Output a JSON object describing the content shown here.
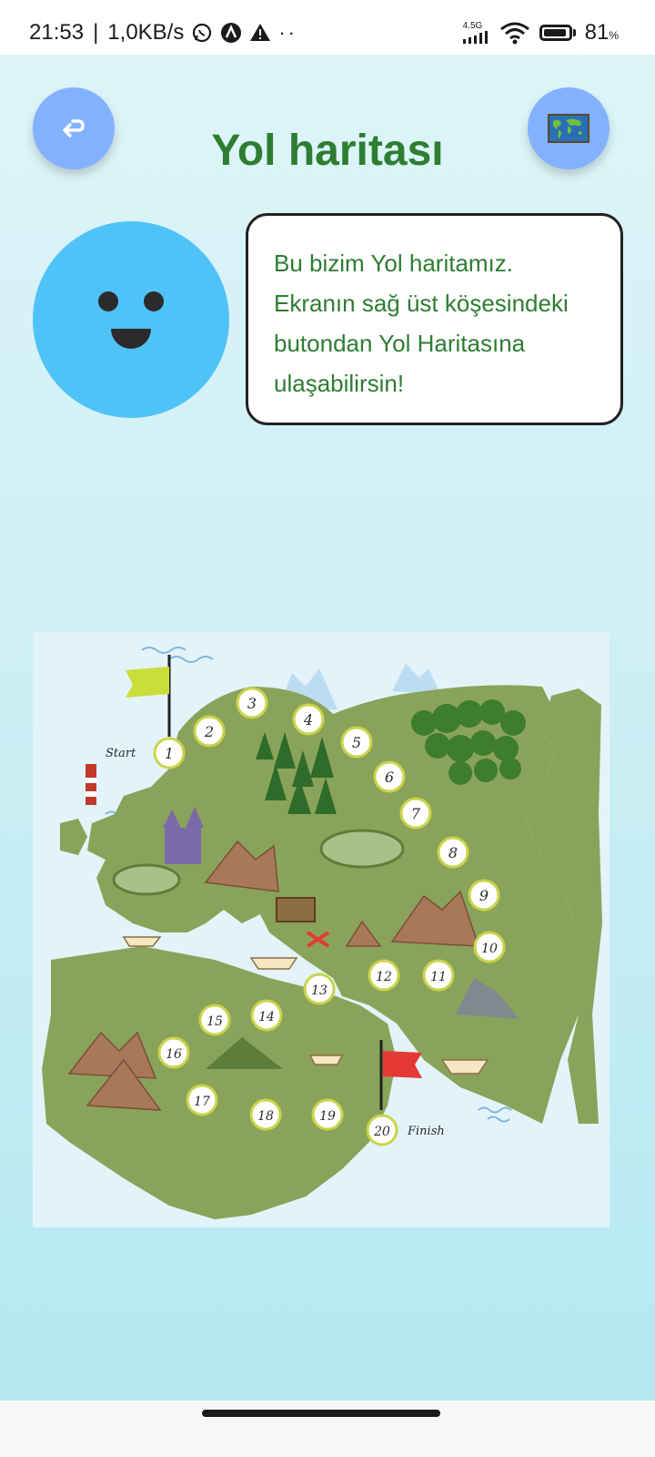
{
  "status_bar": {
    "time": "21:53",
    "speed": "1,0KB/s",
    "left_icons": [
      "whatsapp-icon",
      "app-a-icon",
      "warning-icon"
    ],
    "dots": "··",
    "network_label": "4.5G",
    "battery_percent": "81",
    "percent_sign": "%"
  },
  "header": {
    "title": "Yol haritası",
    "back_icon": "return-arrow-icon",
    "map_icon": "world-map-icon"
  },
  "speech_bubble": {
    "text": "Bu bizim Yol haritamız. Ekranın sağ üst köşesindeki butondan Yol Haritasına ulaşabilirsin!"
  },
  "roadmap": {
    "start_label": "Start",
    "finish_label": "Finish",
    "steps": [
      "1",
      "2",
      "3",
      "4",
      "5",
      "6",
      "7",
      "8",
      "9",
      "10",
      "11",
      "12",
      "13",
      "14",
      "15",
      "16",
      "17",
      "18",
      "19",
      "20"
    ]
  },
  "colors": {
    "title_green": "#2e7d32",
    "button_blue": "#82b1ff",
    "mascot_blue": "#4fc3f7",
    "land_green": "#8aa35a",
    "sea": "#e3f3fa"
  }
}
